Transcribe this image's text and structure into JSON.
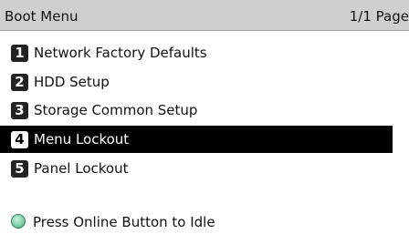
{
  "header": {
    "title": "Boot Menu",
    "page_indicator": "1/1 Page"
  },
  "menu": {
    "selected_index": 3,
    "items": [
      {
        "number": "1",
        "label": "Network Factory Defaults"
      },
      {
        "number": "2",
        "label": "HDD Setup"
      },
      {
        "number": "3",
        "label": "Storage Common Setup"
      },
      {
        "number": "4",
        "label": "Menu Lockout"
      },
      {
        "number": "5",
        "label": "Panel Lockout"
      }
    ]
  },
  "status": {
    "icon": "online-led-icon",
    "icon_color": "#7fd0aa",
    "text": "Press Online Button to Idle"
  }
}
